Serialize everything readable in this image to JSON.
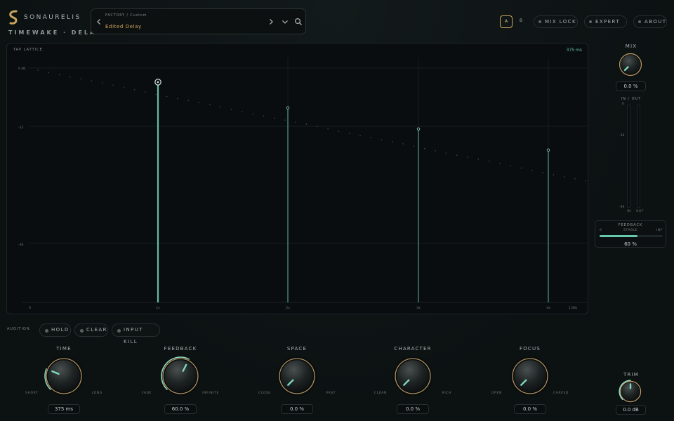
{
  "header": {
    "brand": "SONAURELIS",
    "product": "TIMEWAKE · DELAY",
    "preset_path": "FACTORY / Custom",
    "preset_name": "Edited Delay",
    "ab_a": "A",
    "ab_b": "B",
    "ab_selected": "A",
    "mix_lock": "MIX LOCK",
    "expert": "EXPERT",
    "about": "ABOUT",
    "prev_icon": "chevron-left-icon",
    "next_icon": "chevron-right-icon",
    "menu_icon": "chevron-down-icon",
    "search_icon": "search-icon"
  },
  "lattice": {
    "title": "TAP LATTICE",
    "time_readout": "375 ms",
    "y_tick_labels": [
      "0 dB",
      "-12",
      "-36"
    ],
    "x_tick_labels": [
      "0",
      "1x",
      "2x",
      "3x",
      "4x",
      "1.08s"
    ],
    "taps": [
      {
        "label": "1x",
        "level": 0.94
      },
      {
        "label": "2x",
        "level": 0.83
      },
      {
        "label": "3x",
        "level": 0.74
      },
      {
        "label": "4x",
        "level": 0.65
      }
    ],
    "selected_tap": 0,
    "accent": "#67c8ab"
  },
  "audition": {
    "label": "AUDITION",
    "hold": "HOLD",
    "clear": "CLEAR",
    "input_kill": "INPUT KILL"
  },
  "knobs": [
    {
      "id": "time",
      "title": "TIME",
      "min": "SHORT",
      "max": "LONG",
      "value": "375 ms",
      "pos": 0.25
    },
    {
      "id": "feedback",
      "title": "FEEDBACK",
      "min": "FADE",
      "max": "INFINITE",
      "value": "60.0 %",
      "pos": 0.6
    },
    {
      "id": "space",
      "title": "SPACE",
      "min": "CLOSE",
      "max": "VAST",
      "value": "0.0 %",
      "pos": 0.0
    },
    {
      "id": "character",
      "title": "CHARACTER",
      "min": "CLEAN",
      "max": "RICH",
      "value": "0.0 %",
      "pos": 0.0
    },
    {
      "id": "focus",
      "title": "FOCUS",
      "min": "OPEN",
      "max": "CARVED",
      "value": "0.0 %",
      "pos": 0.0
    }
  ],
  "side": {
    "mix_label": "MIX",
    "mix_value": "0.0 %",
    "mix_pos": 0.0,
    "io_label": "IN / OUT",
    "io_ticks": [
      "0",
      "-36",
      "-90"
    ],
    "in_label": "IN",
    "out_label": "OUT",
    "in_level": 0.0,
    "out_level": 0.0,
    "fb_title": "FEEDBACK",
    "fb_min": "0",
    "fb_mid": "STABLE",
    "fb_max": "INF",
    "fb_value": "60 %",
    "fb_level": 0.6,
    "trim_label": "TRIM",
    "trim_value": "0.0 dB",
    "trim_pos": 0.5
  }
}
